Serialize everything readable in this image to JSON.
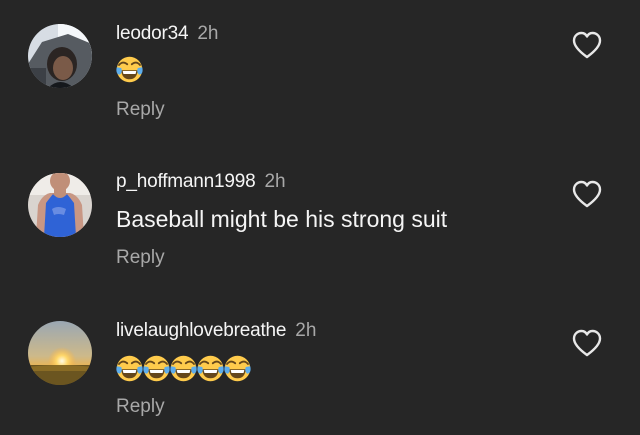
{
  "comments": [
    {
      "username": "leodor34",
      "time": "2h",
      "text": "",
      "emoji_count": 1,
      "emoji": "face-with-tears-of-joy",
      "reply_label": "Reply",
      "avatar": "profile-photo-car-selfie"
    },
    {
      "username": "p_hoffmann1998",
      "time": "2h",
      "text": "Baseball might be his strong suit",
      "emoji_count": 0,
      "emoji": "",
      "reply_label": "Reply",
      "avatar": "profile-photo-blue-tank-top"
    },
    {
      "username": "livelaughlovebreathe",
      "time": "2h",
      "text": "",
      "emoji_count": 5,
      "emoji": "face-with-tears-of-joy",
      "reply_label": "Reply",
      "avatar": "profile-photo-sunset"
    }
  ],
  "icons": {
    "like": "heart-outline-icon"
  },
  "colors": {
    "background": "#262626",
    "primary_text": "#f5f5f5",
    "secondary_text": "#a8a8a8"
  }
}
